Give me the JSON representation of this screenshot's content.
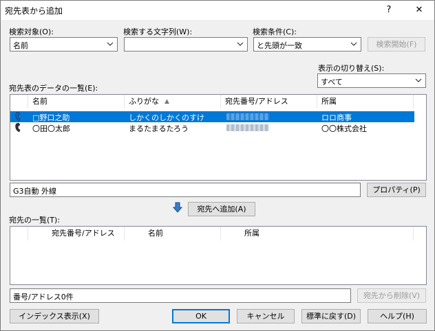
{
  "window": {
    "title": "宛先表から追加",
    "help_glyph": "?",
    "close_glyph": "✕"
  },
  "search": {
    "target_label": "検索対象(O):",
    "target_value": "名前",
    "text_label": "検索する文字列(W):",
    "text_value": "",
    "condition_label": "検索条件(C):",
    "condition_value": "と先頭が一致",
    "start_button": "検索開始(F)"
  },
  "display_switch": {
    "label": "表示の切り替え(S):",
    "value": "すべて"
  },
  "address_list": {
    "label": "宛先表のデータの一覧(E):",
    "columns": [
      "名前",
      "ふりがな",
      "宛先番号/アドレス",
      "所属"
    ],
    "sort_indicator": "▲",
    "rows": [
      {
        "name": "□野口之助",
        "furigana": "しかくのしかくのすけ",
        "company": "ロロ商事",
        "selected": true
      },
      {
        "name": "〇田〇太郎",
        "furigana": "まるたまるたろう",
        "company": "〇〇株式会社",
        "selected": false
      }
    ]
  },
  "detail": {
    "value": "G3自動 外線",
    "property_button": "プロパティ(P)"
  },
  "add_button": "宛先へ追加(A)",
  "destination_list": {
    "label": "宛先の一覧(T):",
    "columns": [
      "宛先番号/アドレス",
      "名前",
      "所属"
    ]
  },
  "count": {
    "value": "番号/アドレス0件",
    "delete_button": "宛先から削除(V)"
  },
  "footer": {
    "index_button": "インデックス表示(X)",
    "ok_button": "OK",
    "cancel_button": "キャンセル",
    "reset_button": "標準に戻す(D)",
    "help_button": "ヘルプ(H)"
  },
  "colors": {
    "accent": "#0078d7",
    "list_border": "#828790",
    "button_face": "#e1e1e1"
  }
}
